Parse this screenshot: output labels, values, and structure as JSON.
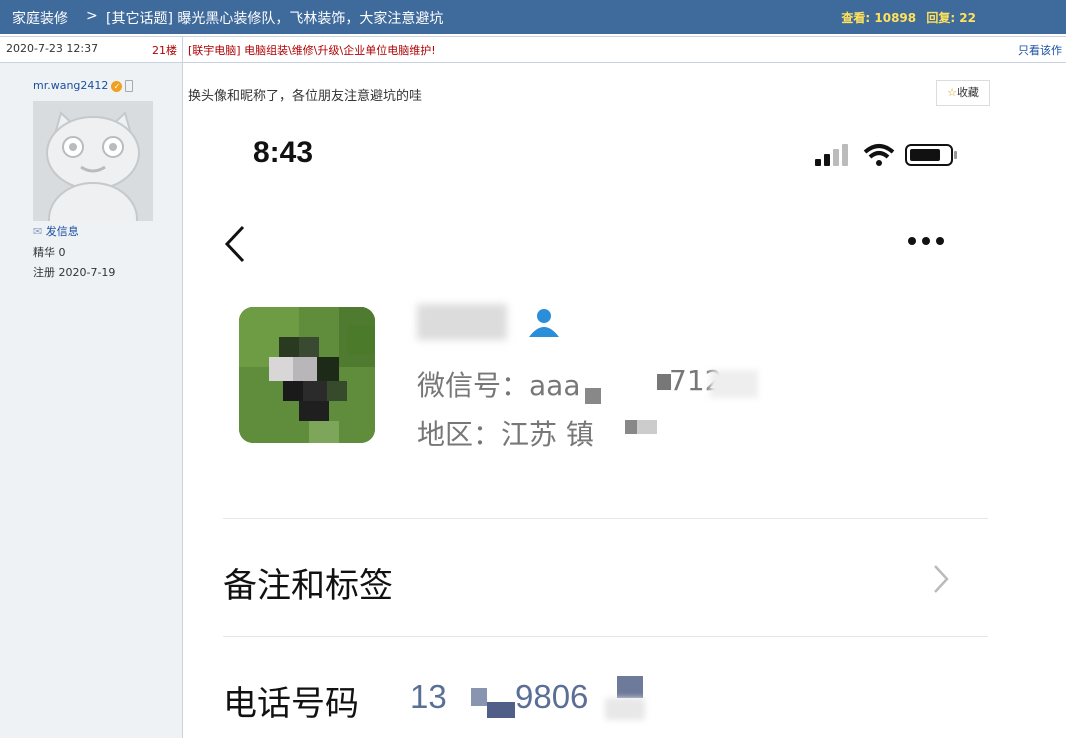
{
  "topbar": {
    "section": "家庭装修",
    "arrow": ">",
    "title": "[其它话题] 曝光黑心装修队，飞林装饰，大家注意避坑",
    "views_label": "查看: 10898",
    "replies_label": "回复: 22"
  },
  "post_info": {
    "date": "2020-7-23 12:37",
    "floor": "21楼",
    "ad_text": "[联宇电脑] 电脑组装\\维修\\升级\\企业单位电脑维护!",
    "only_author": "只看该作"
  },
  "author": {
    "username": "mr.wang2412",
    "send_message": "发信息",
    "essence": "精华 0",
    "registered": "注册 2020-7-19"
  },
  "post": {
    "text": "换头像和昵称了，各位朋友注意避坑的哇",
    "favorite": "收藏"
  },
  "screenshot": {
    "time": "8:43",
    "wechat_id": "微信号：aaa",
    "wechat_id_tail": "712",
    "region": "地区：江苏 镇",
    "remark_tags": "备注和标签",
    "phone_label": "电话号码",
    "phone_prefix": "13",
    "phone_middle": "9806"
  },
  "colors": {
    "topbar_bg": "#3f6a9c",
    "stats": "#ffe25a",
    "link": "#1a4fa0",
    "red": "#b00000"
  }
}
